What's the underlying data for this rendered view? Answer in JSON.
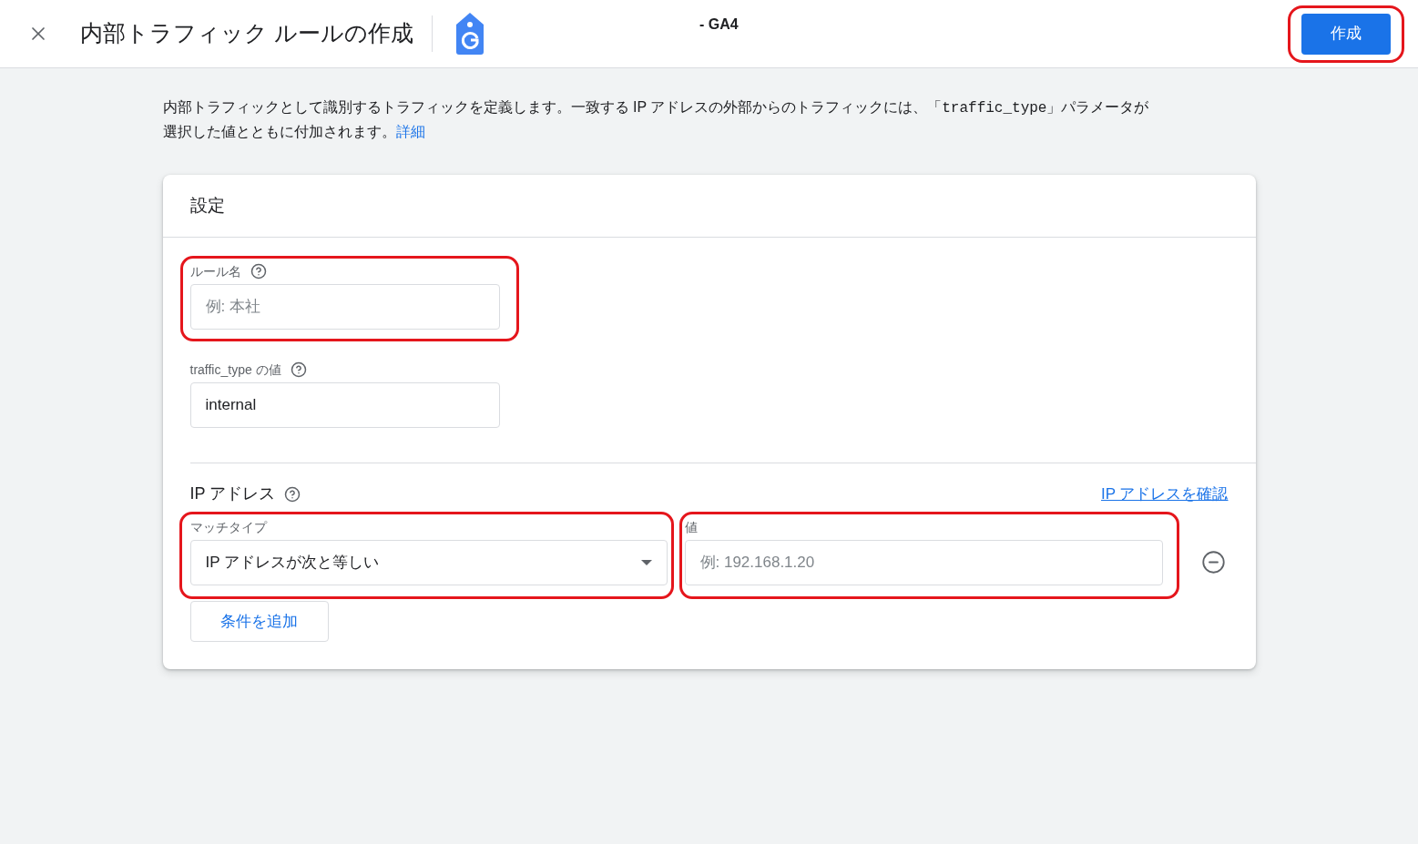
{
  "header": {
    "title": "内部トラフィック ルールの作成",
    "app_suffix": "- GA4",
    "create_button": {
      "label": "作成",
      "highlighted": true
    }
  },
  "description": {
    "before": "内部トラフィックとして識別するトラフィックを定義します。一致する IP アドレスの外部からのトラフィックには、「",
    "code": "traffic_type",
    "after": "」パラメータが選択した値とともに付加されます。",
    "link": "詳細"
  },
  "card": {
    "title": "設定",
    "fields": [
      {
        "label": "ルール名",
        "help": true,
        "placeholder": "例: 本社",
        "highlighted": true
      },
      {
        "label": "traffic_type の値",
        "help": true,
        "value": "internal",
        "highlighted": false
      }
    ],
    "ip_section": {
      "title": "IP アドレス",
      "help": true,
      "link": "IP アドレスを確認",
      "conditions": [
        {
          "match_label": "マッチタイプ",
          "match_value": "IP アドレスが次と等しい",
          "match_highlighted": true,
          "value_label": "値",
          "value_placeholder": "例: 192.168.1.20",
          "value_highlighted": true
        }
      ],
      "add_button": "条件を追加"
    }
  }
}
